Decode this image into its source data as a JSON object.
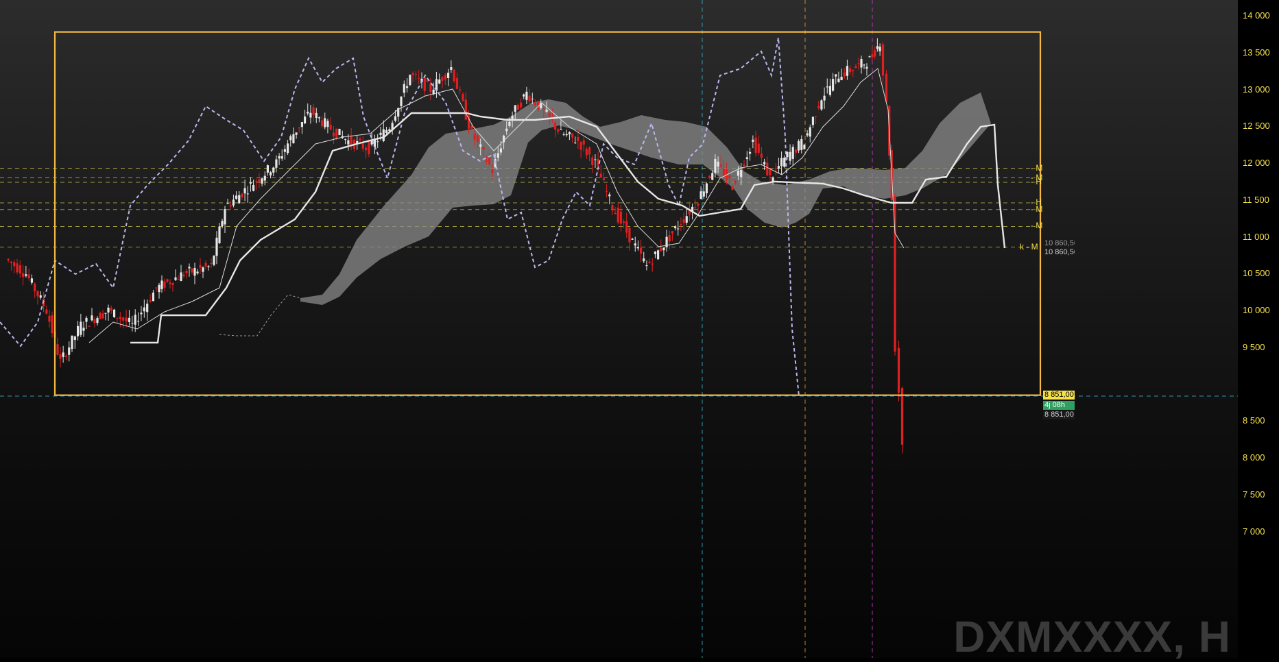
{
  "symbol_watermark": "DXMXXXX, H",
  "colors": {
    "bull": "#e6e6e6",
    "bear": "#e02020",
    "box": "#f5b942",
    "price_text": "#f5e04a",
    "lagging": "#b8b8ee",
    "cloud": "#9a9a9a",
    "guide_cyan": "#3bb6d6",
    "guide_orange": "#f0a030",
    "guide_magenta": "#d040d0"
  },
  "price_axis": {
    "ticks": [
      "14 000",
      "13 500",
      "13 000",
      "12 500",
      "12 000",
      "11 500",
      "11 000",
      "10 500",
      "10 000",
      "9 500",
      "8 500",
      "8 000",
      "7 500",
      "7 000"
    ],
    "values": [
      14000,
      13500,
      13000,
      12500,
      12000,
      11500,
      11000,
      10500,
      10000,
      9500,
      8500,
      8000,
      7500,
      7000
    ],
    "range": [
      6750,
      14200
    ]
  },
  "level_labels": [
    {
      "text": "M",
      "price": 11930
    },
    {
      "text": "M",
      "price": 11800
    },
    {
      "text": "H",
      "price": 11740
    },
    {
      "text": "H",
      "price": 11460
    },
    {
      "text": "M",
      "price": 11370
    },
    {
      "text": "M",
      "price": 11140
    },
    {
      "text": "k - M",
      "price": 10860
    }
  ],
  "price_tags": [
    {
      "text": "10 860,50",
      "price": 10910,
      "bg": "#1a1a1a",
      "fg": "#9a9a9a"
    },
    {
      "text": "10 860,50",
      "price": 10790,
      "bg": "#1a1a1a",
      "fg": "#cfcfcf"
    },
    {
      "text": "8 851,00",
      "price": 8855,
      "bg": "#f5e04a",
      "fg": "#000000"
    },
    {
      "text": "4j 08h",
      "price": 8720,
      "bg": "#2fa060",
      "fg": "#ffffff"
    },
    {
      "text": "8 851,00",
      "price": 8590,
      "bg": "#1a1a1a",
      "fg": "#cfcfcf"
    }
  ],
  "chart_data": {
    "type": "candlestick",
    "ylim": [
      6750,
      14200
    ],
    "range_box": {
      "high": 13780,
      "low": 8850
    },
    "horizontal_levels": [
      11930,
      11800,
      11740,
      11460,
      11370,
      11140,
      10860
    ],
    "current_price": 8851,
    "key_prices": {
      "high": 13780,
      "low": 7900,
      "last": 8200
    }
  }
}
